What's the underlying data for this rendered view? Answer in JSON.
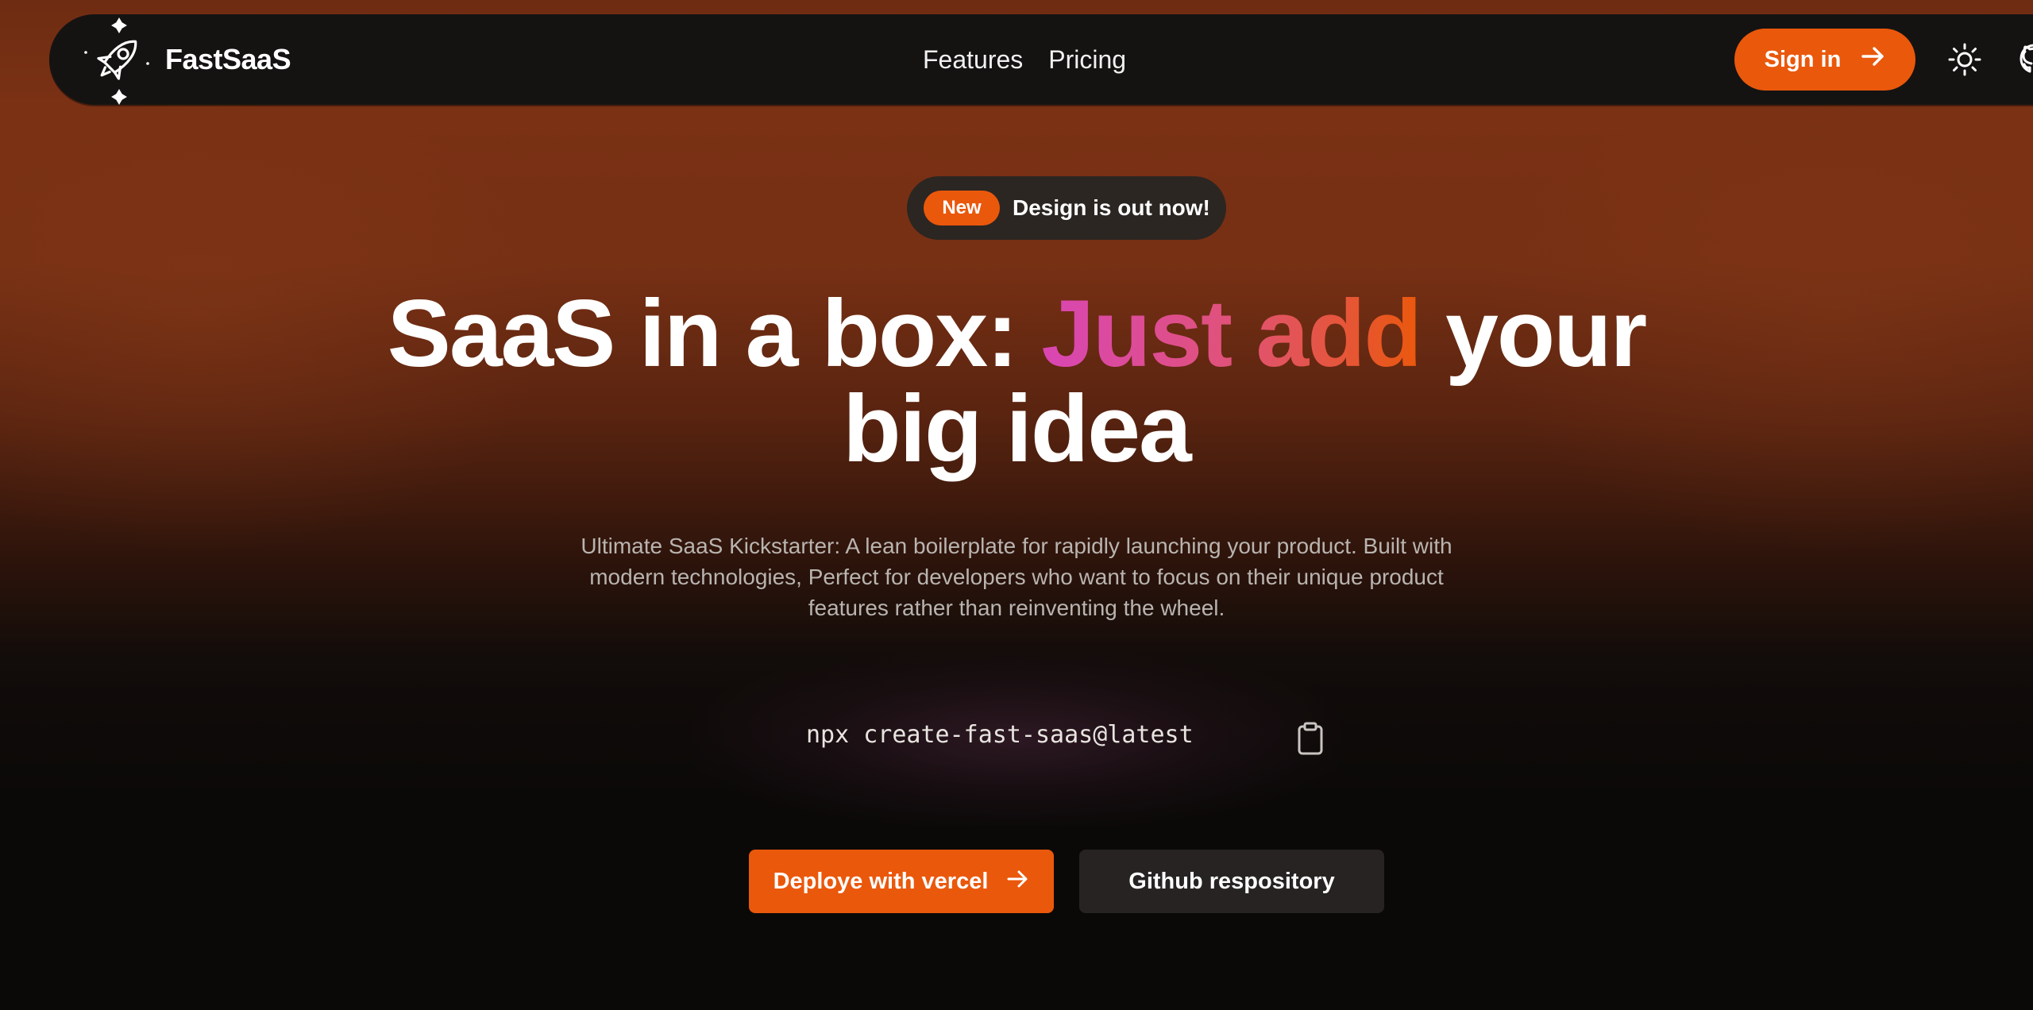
{
  "navbar": {
    "brand_name": "FastSaaS",
    "links": [
      {
        "label": "Features"
      },
      {
        "label": "Pricing"
      }
    ],
    "signin_label": "Sign in",
    "icons": [
      "rocket-logo-icon",
      "arrow-right-icon",
      "sun-icon",
      "github-icon"
    ]
  },
  "badge": {
    "pill": "New",
    "text": "Design is out now!"
  },
  "hero": {
    "headline_part1": "SaaS in a box:",
    "headline_highlight": "Just add",
    "headline_part2": "your",
    "headline_line2": "big idea",
    "description": "Ultimate SaaS Kickstarter: A lean boilerplate for rapidly launching your product. Built with modern technologies, Perfect for developers who want to focus on their unique product features rather than reinventing the wheel."
  },
  "command": {
    "text": "npx create-fast-saas@latest",
    "icon": "clipboard-icon"
  },
  "cta": {
    "deploy_label": "Deploye with vercel",
    "github_label": "Github respository"
  },
  "colors": {
    "accent": "#ea580c",
    "gradient_start": "#d946b4",
    "gradient_end": "#ea580c",
    "navbar_bg": "#141312",
    "page_bg_top": "#7a3114",
    "page_bg_bottom": "#0b0908"
  }
}
